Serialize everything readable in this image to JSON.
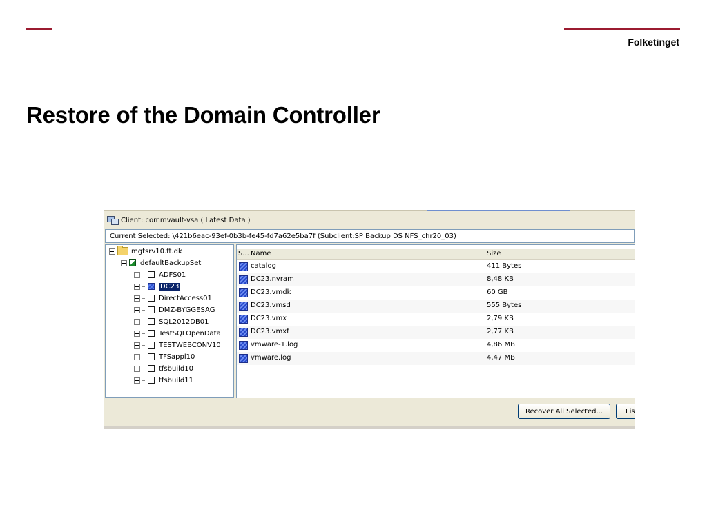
{
  "header": {
    "brand": "Folketinget",
    "accent_color": "#9b1b30"
  },
  "slide": {
    "title": "Restore of the Domain Controller"
  },
  "app": {
    "client_title": "Client: commvault-vsa ( Latest Data )",
    "current_selected": "Current Selected: \\421b6eac-93ef-0b3b-fe45-fd7a62e5ba7f (Subclient:SP Backup DS NFS_chr20_03)",
    "tree": {
      "root": "mgtsrv10.ft.dk",
      "backupset": "defaultBackupSet",
      "items": [
        {
          "label": "ADFS01",
          "selected": false
        },
        {
          "label": "DC23",
          "selected": true
        },
        {
          "label": "DirectAccess01",
          "selected": false
        },
        {
          "label": "DMZ-BYGGESAG",
          "selected": false
        },
        {
          "label": "SQL2012DB01",
          "selected": false
        },
        {
          "label": "TestSQLOpenData",
          "selected": false
        },
        {
          "label": "TESTWEBCONV10",
          "selected": false
        },
        {
          "label": "TFSappl10",
          "selected": false
        },
        {
          "label": "tfsbuild10",
          "selected": false
        },
        {
          "label": "tfsbuild11",
          "selected": false
        }
      ]
    },
    "list": {
      "columns": {
        "s": "S...",
        "name": "Name",
        "size": "Size"
      },
      "rows": [
        {
          "name": "catalog",
          "size": "411 Bytes"
        },
        {
          "name": "DC23.nvram",
          "size": "8,48 KB"
        },
        {
          "name": "DC23.vmdk",
          "size": "60 GB"
        },
        {
          "name": "DC23.vmsd",
          "size": "555 Bytes"
        },
        {
          "name": "DC23.vmx",
          "size": "2,79 KB"
        },
        {
          "name": "DC23.vmxf",
          "size": "2,77 KB"
        },
        {
          "name": "vmware-1.log",
          "size": "4,86 MB"
        },
        {
          "name": "vmware.log",
          "size": "4,47 MB"
        }
      ]
    },
    "buttons": {
      "recover_all": "Recover All Selected...",
      "list": "Lis"
    }
  }
}
